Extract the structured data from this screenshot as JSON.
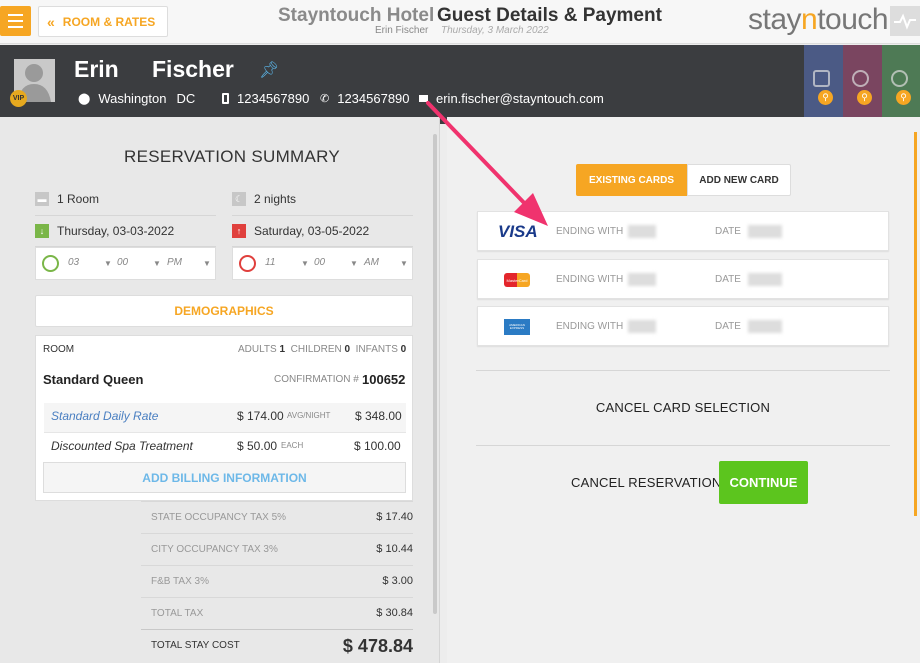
{
  "topbar": {
    "back_label": "ROOM & RATES",
    "hotel_name": "Stayntouch Hotel",
    "page_title": "Guest Details & Payment",
    "guest_name": "Erin Fischer",
    "date": "Thursday, 3 March 2022",
    "logo_pre": "stay",
    "logo_accent": "n",
    "logo_post": "touch"
  },
  "guest": {
    "vip": "VIP",
    "first_name": "Erin",
    "last_name": "Fischer",
    "city": "Washington",
    "state": "DC",
    "mobile": "1234567890",
    "phone": "1234567890",
    "email": "erin.fischer@stayntouch.com"
  },
  "side_tabs": [
    {
      "name": "building",
      "color": "#4b5a85"
    },
    {
      "name": "globe",
      "color": "#7a4560"
    },
    {
      "name": "group",
      "color": "#4e7a55"
    }
  ],
  "summary": {
    "title": "RESERVATION SUMMARY",
    "rooms": "1 Room",
    "nights": "2 nights",
    "arrival_date": "Thursday, 03-03-2022",
    "departure_date": "Saturday, 03-05-2022",
    "arrival_time": {
      "hour": "03",
      "min": "00",
      "ampm": "PM"
    },
    "departure_time": {
      "hour": "11",
      "min": "00",
      "ampm": "AM"
    },
    "demographics_label": "DEMOGRAPHICS"
  },
  "room": {
    "label": "ROOM",
    "adults_label": "ADULTS",
    "adults": "1",
    "children_label": "CHILDREN",
    "children": "0",
    "infants_label": "INFANTS",
    "infants": "0",
    "type": "Standard Queen",
    "confirmation_label": "CONFIRMATION #",
    "confirmation": "100652",
    "rate_name": "Standard Daily Rate",
    "rate_price": "$ 174.00",
    "rate_unit": "AVG/NIGHT",
    "rate_total": "$ 348.00",
    "addon_name": "Discounted Spa Treatment",
    "addon_price": "$ 50.00",
    "addon_unit": "EACH",
    "addon_total": "$ 100.00",
    "billing_label": "ADD BILLING INFORMATION"
  },
  "taxes": [
    {
      "label": "STATE OCCUPANCY TAX 5%",
      "value": "$ 17.40"
    },
    {
      "label": "CITY OCCUPANCY TAX 3%",
      "value": "$ 10.44"
    },
    {
      "label": "F&B TAX 3%",
      "value": "$ 3.00"
    },
    {
      "label": "TOTAL TAX",
      "value": "$ 30.84"
    }
  ],
  "total": {
    "label": "TOTAL STAY COST",
    "value": "$ 478.84"
  },
  "payment": {
    "tab_existing": "EXISTING CARDS",
    "tab_new": "ADD NEW CARD",
    "ending_label": "ENDING WITH",
    "date_label": "DATE",
    "cards": [
      {
        "brand": "VISA"
      },
      {
        "brand": "MasterCard"
      },
      {
        "brand": "AMERICAN EXPRESS"
      }
    ],
    "cancel_card": "CANCEL CARD SELECTION",
    "cancel_reservation": "CANCEL RESERVATION",
    "continue": "CONTINUE"
  },
  "colors": {
    "accent": "#f6a623",
    "green": "#5cc51e",
    "arrow": "#f0336e",
    "link": "#4a7fc1"
  }
}
